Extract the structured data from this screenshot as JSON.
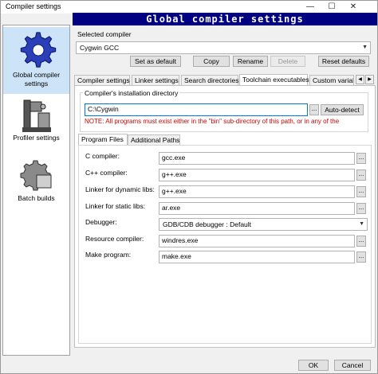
{
  "window": {
    "title": "Compiler settings",
    "minimize_glyph": "—",
    "maximize_glyph": "☐",
    "close_glyph": "✕"
  },
  "header": {
    "title": "Global compiler settings"
  },
  "sidebar": {
    "items": [
      {
        "label": "Global compiler settings",
        "icon": "gear-icon",
        "selected": true
      },
      {
        "label": "Profiler settings",
        "icon": "profiler-icon",
        "selected": false
      },
      {
        "label": "Batch builds",
        "icon": "batch-gear-icon",
        "selected": false
      }
    ]
  },
  "compiler": {
    "selected_label": "Selected compiler",
    "selected_value": "Cygwin GCC",
    "buttons": {
      "set_default": "Set as default",
      "copy": "Copy",
      "rename": "Rename",
      "delete": "Delete",
      "reset_defaults": "Reset defaults"
    }
  },
  "tabs": [
    {
      "label": "Compiler settings",
      "active": false
    },
    {
      "label": "Linker settings",
      "active": false
    },
    {
      "label": "Search directories",
      "active": false
    },
    {
      "label": "Toolchain executables",
      "active": true
    },
    {
      "label": "Custom variab",
      "active": false
    }
  ],
  "tab_scroll": {
    "left": "◀",
    "right": "▶"
  },
  "toolchain": {
    "install_dir_label": "Compiler's installation directory",
    "install_dir_value": "C:\\Cygwin",
    "dots_label": "...",
    "auto_detect": "Auto-detect",
    "note": "NOTE: All programs must exist either in the \"bin\" sub-directory of this path, or in any of the",
    "subtabs": [
      {
        "label": "Program Files",
        "active": true
      },
      {
        "label": "Additional Paths",
        "active": false
      }
    ],
    "programs": [
      {
        "label": "C compiler:",
        "value": "gcc.exe",
        "type": "input"
      },
      {
        "label": "C++ compiler:",
        "value": "g++.exe",
        "type": "input"
      },
      {
        "label": "Linker for dynamic libs:",
        "value": "g++.exe",
        "type": "input"
      },
      {
        "label": "Linker for static libs:",
        "value": "ar.exe",
        "type": "input"
      },
      {
        "label": "Debugger:",
        "value": "GDB/CDB debugger : Default",
        "type": "select"
      },
      {
        "label": "Resource compiler:",
        "value": "windres.exe",
        "type": "input"
      },
      {
        "label": "Make program:",
        "value": "make.exe",
        "type": "input"
      }
    ]
  },
  "footer": {
    "ok": "OK",
    "cancel": "Cancel"
  },
  "colors": {
    "header_bg": "#000080",
    "note_text": "#d00000",
    "selection": "#cde3f7",
    "focus": "#0078d7"
  }
}
